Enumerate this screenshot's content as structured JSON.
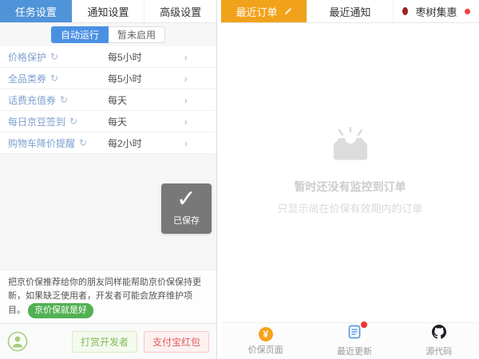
{
  "icons": {
    "refresh": "↻",
    "chevron": "›",
    "check": "✓",
    "yuan": "¥"
  },
  "left": {
    "tabs": [
      {
        "label": "任务设置",
        "active": true
      },
      {
        "label": "通知设置",
        "active": false
      },
      {
        "label": "高级设置",
        "active": false
      }
    ],
    "toggle": {
      "on_label": "自动运行",
      "off_label": "暂未启用"
    },
    "tasks": [
      {
        "label": "价格保护",
        "frequency": "每5小时"
      },
      {
        "label": "全品类券",
        "frequency": "每5小时"
      },
      {
        "label": "话费充值券",
        "frequency": "每天"
      },
      {
        "label": "每日京豆签到",
        "frequency": "每天"
      },
      {
        "label": "购物车降价提醒",
        "frequency": "每2小时"
      }
    ],
    "saved_toast": "已保存",
    "promo_text": "把京价保推荐给你的朋友同样能帮助京价保保持更新，如果缺乏使用者，开发者可能会放弃维护项目。",
    "promo_badge": "京价保就是好",
    "donate_button": "打赏开发者",
    "alipay_button": "支付宝红包"
  },
  "right": {
    "tabs": [
      {
        "label": "最近订单",
        "active": true
      },
      {
        "label": "最近通知",
        "active": false
      },
      {
        "label": "枣树集惠",
        "active": false
      }
    ],
    "empty_title": "暂时还没有监控到订单",
    "empty_subtitle": "只显示尚在价保有效期内的订单",
    "nav": [
      {
        "label": "价保页面"
      },
      {
        "label": "最近更新"
      },
      {
        "label": "源代码"
      }
    ]
  },
  "colors": {
    "accent_blue": "#4a90e2",
    "accent_orange": "#f0a21b",
    "accent_green": "#52b152",
    "alert_red": "#f0413c"
  }
}
